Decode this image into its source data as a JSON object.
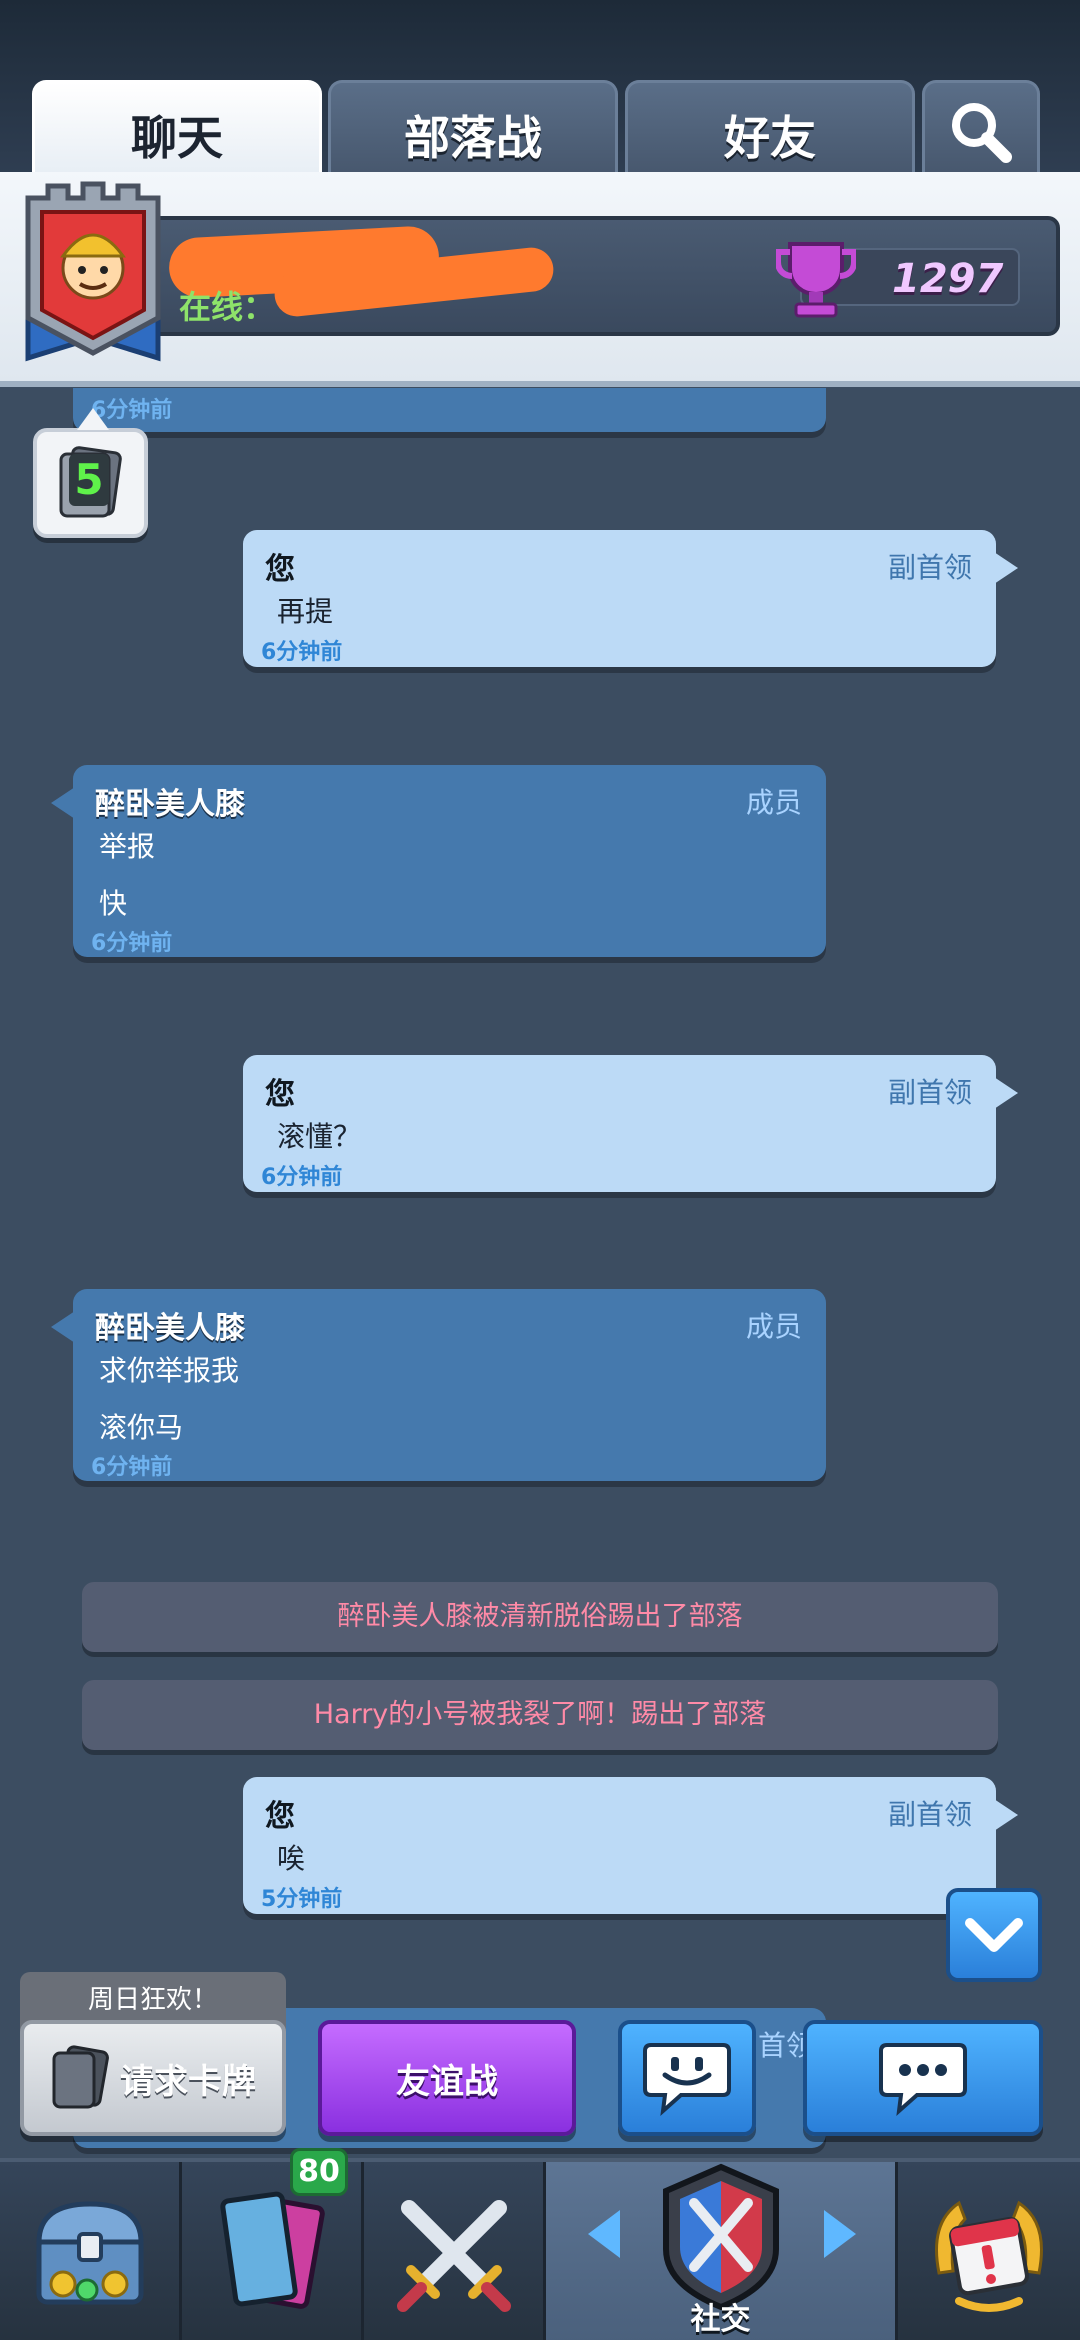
{
  "tabs": [
    {
      "label": "聊天",
      "active": true
    },
    {
      "label": "部落战",
      "active": false
    },
    {
      "label": "好友",
      "active": false
    }
  ],
  "search_icon": "search-icon",
  "clan": {
    "online_label": "在线：",
    "trophies": "1297"
  },
  "card_request_count": "5",
  "partial_top_time": "6分钟前",
  "messages": [
    {
      "type": "me",
      "name": "您",
      "role": "副首领",
      "lines": [
        "再提"
      ],
      "time": "6分钟前"
    },
    {
      "type": "other",
      "name": "醉卧美人膝",
      "role": "成员",
      "lines": [
        "举报",
        "快"
      ],
      "time": "6分钟前"
    },
    {
      "type": "me",
      "name": "您",
      "role": "副首领",
      "lines": [
        "滚懂？"
      ],
      "time": "6分钟前"
    },
    {
      "type": "other",
      "name": "醉卧美人膝",
      "role": "成员",
      "lines": [
        "求你举报我",
        "滚你马"
      ],
      "time": "6分钟前"
    }
  ],
  "system_messages": [
    "醉卧美人膝被清新脱俗踢出了部落",
    "Harry的小号被我裂了啊！踢出了部落"
  ],
  "last_message": {
    "type": "me",
    "name": "您",
    "role": "副首领",
    "lines": [
      "唉"
    ],
    "time": "5分钟前"
  },
  "partial_bottom_role": "首领",
  "sunday_tag": "周日狂欢！",
  "buttons": {
    "request_cards": "请求卡牌",
    "friendly_battle": "友谊战"
  },
  "nav": {
    "cards_badge": "80",
    "social_label": "社交"
  },
  "colors": {
    "me_bubble": "#bcdaf6",
    "other_bubble": "#4579ad",
    "system_text": "#ff8aa7",
    "trophy_purple": "#c44bd6",
    "friendly_purple": "#a64cf0",
    "blue_button": "#3a99f0"
  }
}
